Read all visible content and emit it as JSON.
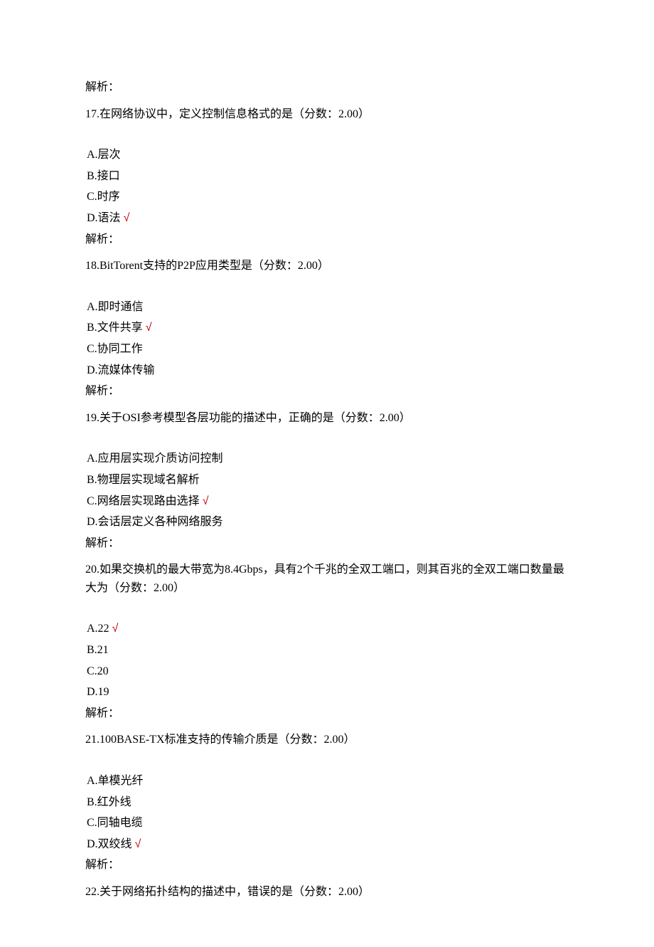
{
  "preAnalysis": "解析：",
  "questions": [
    {
      "num": "17",
      "stem": "在网络协议中，定义控制信息格式的是（分数：2.00）",
      "options": [
        {
          "label": "A.层次",
          "correct": false
        },
        {
          "label": "B.接口",
          "correct": false
        },
        {
          "label": "C.时序",
          "correct": false
        },
        {
          "label": "D.语法",
          "correct": true
        }
      ],
      "analysis": "解析："
    },
    {
      "num": "18",
      "stem": "BitTorent支持的P2P应用类型是（分数：2.00）",
      "options": [
        {
          "label": "A.即时通信",
          "correct": false
        },
        {
          "label": "B.文件共享",
          "correct": true
        },
        {
          "label": "C.协同工作",
          "correct": false
        },
        {
          "label": "D.流媒体传输",
          "correct": false
        }
      ],
      "analysis": "解析："
    },
    {
      "num": "19",
      "stem": "关于OSI参考模型各层功能的描述中，正确的是（分数：2.00）",
      "options": [
        {
          "label": "A.应用层实现介质访问控制",
          "correct": false
        },
        {
          "label": "B.物理层实现域名解析",
          "correct": false
        },
        {
          "label": "C.网络层实现路由选择",
          "correct": true
        },
        {
          "label": "D.会话层定义各种网络服务",
          "correct": false
        }
      ],
      "analysis": "解析："
    },
    {
      "num": "20",
      "stem": "如果交换机的最大带宽为8.4Gbps，具有2个千兆的全双工端口，则其百兆的全双工端口数量最大为（分数：2.00）",
      "options": [
        {
          "label": "A.22",
          "correct": true
        },
        {
          "label": "B.21",
          "correct": false
        },
        {
          "label": "C.20",
          "correct": false
        },
        {
          "label": "D.19",
          "correct": false
        }
      ],
      "analysis": "解析："
    },
    {
      "num": "21",
      "stem": "100BASE-TX标准支持的传输介质是（分数：2.00）",
      "options": [
        {
          "label": "A.单模光纤",
          "correct": false
        },
        {
          "label": "B.红外线",
          "correct": false
        },
        {
          "label": "C.同轴电缆",
          "correct": false
        },
        {
          "label": "D.双绞线",
          "correct": true
        }
      ],
      "analysis": "解析："
    },
    {
      "num": "22",
      "stem": "关于网络拓扑结构的描述中，错误的是（分数：2.00）",
      "options": [],
      "analysis": ""
    }
  ],
  "checkmark": "√"
}
